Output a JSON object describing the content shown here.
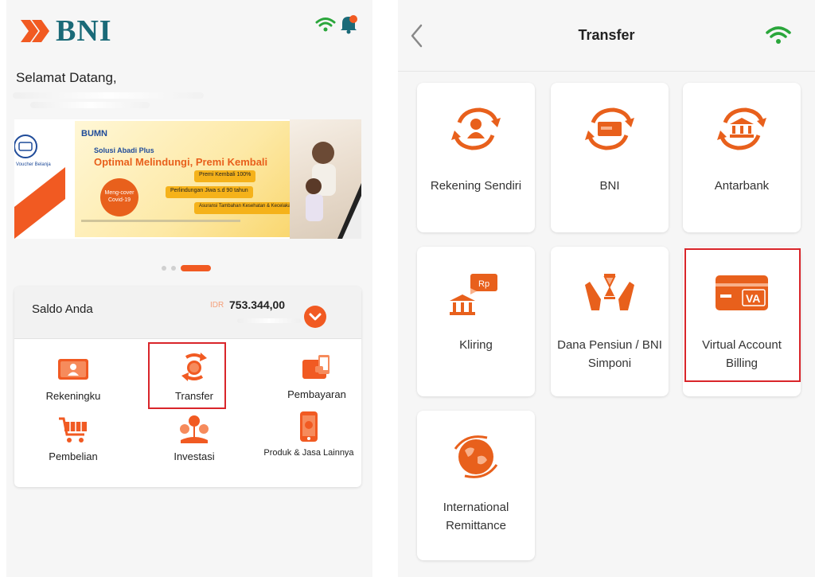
{
  "home": {
    "brand": "BNI",
    "welcome": "Selamat Datang,",
    "banner": {
      "left_caption": "Voucher Belanja",
      "brand": "BUMN",
      "subtitle": "Solusi Abadi Plus",
      "title": "Optimal Melindungi, Premi Kembali",
      "pills": [
        "Premi Kembali 100%",
        "Perlindungan Jiwa s.d 90 tahun",
        "Asuransi Tambahan Kesehatan & Kecelakaan"
      ],
      "badge": "Meng-cover Covid-19"
    },
    "saldo": {
      "label": "Saldo Anda",
      "currency": "IDR",
      "value": "753.344,00"
    },
    "menu": [
      {
        "label": "Rekeningku",
        "icon": "card-icon"
      },
      {
        "label": "Transfer",
        "icon": "transfer-icon"
      },
      {
        "label": "Pembayaran",
        "icon": "wallet-icon"
      },
      {
        "label": "Pembelian",
        "icon": "cart-icon"
      },
      {
        "label": "Investasi",
        "icon": "investment-icon"
      },
      {
        "label": "Produk & Jasa Lainnya",
        "icon": "phone-icon"
      }
    ],
    "carousel": {
      "count": 3,
      "active": 3
    }
  },
  "transfer": {
    "title": "Transfer",
    "options": [
      {
        "label": "Rekening Sendiri",
        "icon": "own-account-icon"
      },
      {
        "label": "BNI",
        "icon": "bni-card-icon"
      },
      {
        "label": "Antarbank",
        "icon": "bank-icon"
      },
      {
        "label": "Kliring",
        "icon": "clearing-icon"
      },
      {
        "label": "Dana Pensiun / BNI Simponi",
        "icon": "pension-icon"
      },
      {
        "label": "Virtual Account Billing",
        "icon": "va-card-icon"
      },
      {
        "label": "International Remittance",
        "icon": "globe-icon"
      }
    ],
    "va_text": "VA",
    "rp_text": "Rp"
  },
  "colors": {
    "accent": "#f15a22",
    "brand": "#1a6a78",
    "highlight": "#d9252a",
    "wifi": "#2aa63b"
  }
}
